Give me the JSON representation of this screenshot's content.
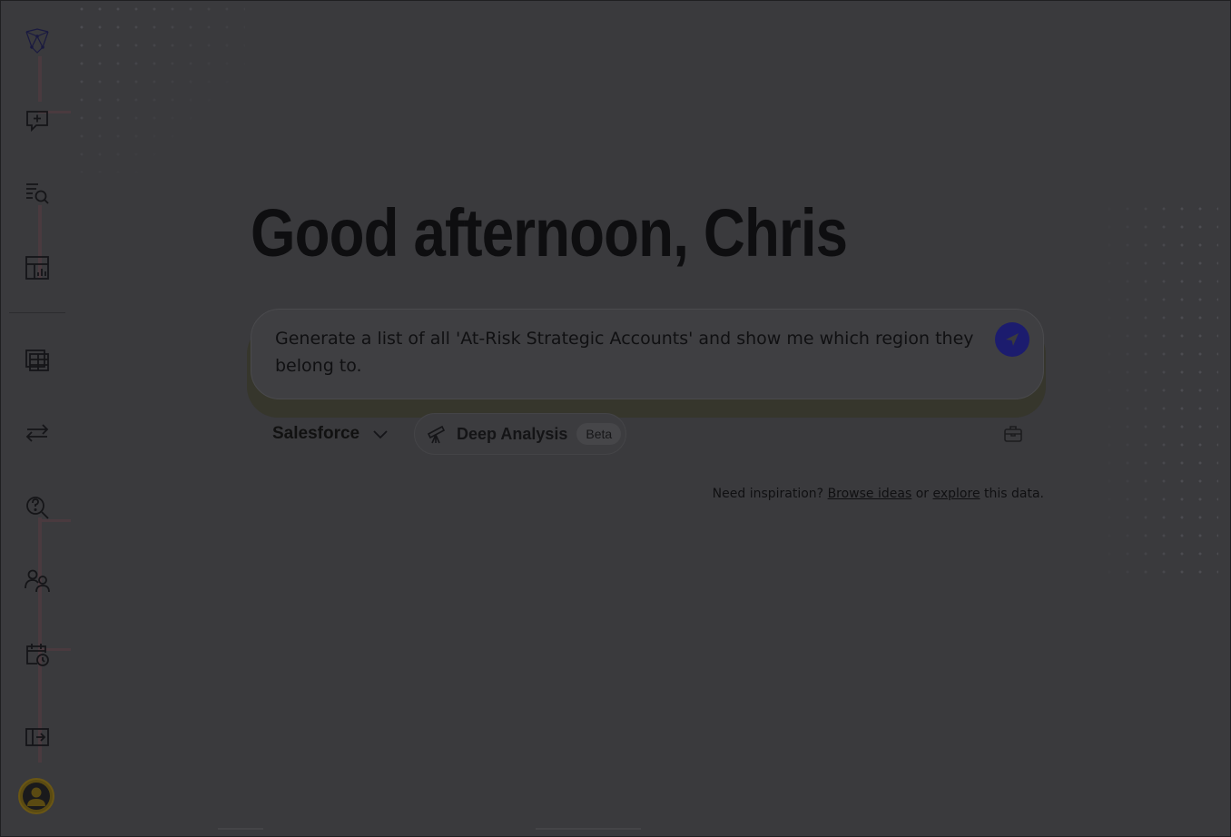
{
  "sidebar": {
    "logo": "app-logo",
    "items": [
      {
        "icon": "new-chat-icon"
      },
      {
        "icon": "search-list-icon"
      },
      {
        "icon": "dashboard-icon"
      },
      {
        "icon": "data-table-icon"
      },
      {
        "icon": "transfer-arrows-icon"
      },
      {
        "icon": "question-search-icon"
      },
      {
        "icon": "users-icon"
      },
      {
        "icon": "schedule-icon"
      },
      {
        "icon": "expand-sidebar-icon"
      },
      {
        "icon": "user-avatar-icon"
      }
    ]
  },
  "main": {
    "greeting": "Good afternoon, Chris",
    "prompt": {
      "value": "Generate a list of all 'At-Risk Strategic Accounts' and show me which region they belong to.",
      "send_icon": "send-icon"
    },
    "source": {
      "selected": "Salesforce"
    },
    "deep_analysis": {
      "label": "Deep Analysis",
      "badge": "Beta",
      "icon": "telescope-icon"
    },
    "toolbox_icon": "toolbox-icon",
    "inspiration": {
      "prefix": "Need inspiration?",
      "browse_link": "Browse ideas",
      "middle": "or",
      "explore_link": "explore",
      "suffix": "this data."
    }
  },
  "colors": {
    "overlay_background": "#3a3a3d",
    "send_button": "#1c1c6e",
    "avatar": "#5a4a12"
  }
}
